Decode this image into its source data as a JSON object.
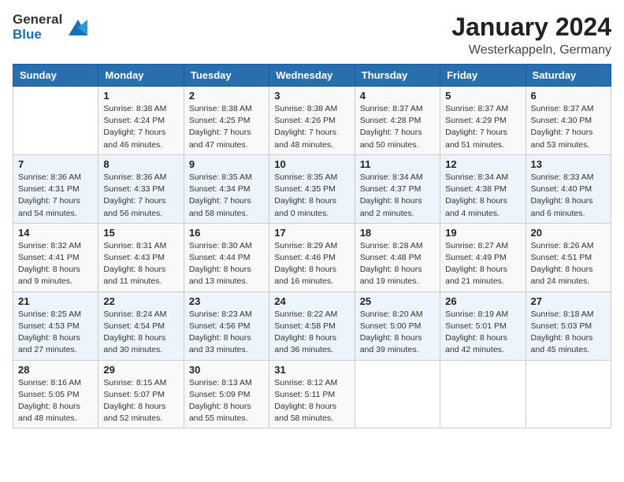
{
  "logo": {
    "general": "General",
    "blue": "Blue"
  },
  "title": "January 2024",
  "location": "Westerkappeln, Germany",
  "days_header": [
    "Sunday",
    "Monday",
    "Tuesday",
    "Wednesday",
    "Thursday",
    "Friday",
    "Saturday"
  ],
  "weeks": [
    [
      {
        "day": "",
        "sunrise": "",
        "sunset": "",
        "daylight": ""
      },
      {
        "day": "1",
        "sunrise": "Sunrise: 8:38 AM",
        "sunset": "Sunset: 4:24 PM",
        "daylight": "Daylight: 7 hours and 46 minutes."
      },
      {
        "day": "2",
        "sunrise": "Sunrise: 8:38 AM",
        "sunset": "Sunset: 4:25 PM",
        "daylight": "Daylight: 7 hours and 47 minutes."
      },
      {
        "day": "3",
        "sunrise": "Sunrise: 8:38 AM",
        "sunset": "Sunset: 4:26 PM",
        "daylight": "Daylight: 7 hours and 48 minutes."
      },
      {
        "day": "4",
        "sunrise": "Sunrise: 8:37 AM",
        "sunset": "Sunset: 4:28 PM",
        "daylight": "Daylight: 7 hours and 50 minutes."
      },
      {
        "day": "5",
        "sunrise": "Sunrise: 8:37 AM",
        "sunset": "Sunset: 4:29 PM",
        "daylight": "Daylight: 7 hours and 51 minutes."
      },
      {
        "day": "6",
        "sunrise": "Sunrise: 8:37 AM",
        "sunset": "Sunset: 4:30 PM",
        "daylight": "Daylight: 7 hours and 53 minutes."
      }
    ],
    [
      {
        "day": "7",
        "sunrise": "Sunrise: 8:36 AM",
        "sunset": "Sunset: 4:31 PM",
        "daylight": "Daylight: 7 hours and 54 minutes."
      },
      {
        "day": "8",
        "sunrise": "Sunrise: 8:36 AM",
        "sunset": "Sunset: 4:33 PM",
        "daylight": "Daylight: 7 hours and 56 minutes."
      },
      {
        "day": "9",
        "sunrise": "Sunrise: 8:35 AM",
        "sunset": "Sunset: 4:34 PM",
        "daylight": "Daylight: 7 hours and 58 minutes."
      },
      {
        "day": "10",
        "sunrise": "Sunrise: 8:35 AM",
        "sunset": "Sunset: 4:35 PM",
        "daylight": "Daylight: 8 hours and 0 minutes."
      },
      {
        "day": "11",
        "sunrise": "Sunrise: 8:34 AM",
        "sunset": "Sunset: 4:37 PM",
        "daylight": "Daylight: 8 hours and 2 minutes."
      },
      {
        "day": "12",
        "sunrise": "Sunrise: 8:34 AM",
        "sunset": "Sunset: 4:38 PM",
        "daylight": "Daylight: 8 hours and 4 minutes."
      },
      {
        "day": "13",
        "sunrise": "Sunrise: 8:33 AM",
        "sunset": "Sunset: 4:40 PM",
        "daylight": "Daylight: 8 hours and 6 minutes."
      }
    ],
    [
      {
        "day": "14",
        "sunrise": "Sunrise: 8:32 AM",
        "sunset": "Sunset: 4:41 PM",
        "daylight": "Daylight: 8 hours and 9 minutes."
      },
      {
        "day": "15",
        "sunrise": "Sunrise: 8:31 AM",
        "sunset": "Sunset: 4:43 PM",
        "daylight": "Daylight: 8 hours and 11 minutes."
      },
      {
        "day": "16",
        "sunrise": "Sunrise: 8:30 AM",
        "sunset": "Sunset: 4:44 PM",
        "daylight": "Daylight: 8 hours and 13 minutes."
      },
      {
        "day": "17",
        "sunrise": "Sunrise: 8:29 AM",
        "sunset": "Sunset: 4:46 PM",
        "daylight": "Daylight: 8 hours and 16 minutes."
      },
      {
        "day": "18",
        "sunrise": "Sunrise: 8:28 AM",
        "sunset": "Sunset: 4:48 PM",
        "daylight": "Daylight: 8 hours and 19 minutes."
      },
      {
        "day": "19",
        "sunrise": "Sunrise: 8:27 AM",
        "sunset": "Sunset: 4:49 PM",
        "daylight": "Daylight: 8 hours and 21 minutes."
      },
      {
        "day": "20",
        "sunrise": "Sunrise: 8:26 AM",
        "sunset": "Sunset: 4:51 PM",
        "daylight": "Daylight: 8 hours and 24 minutes."
      }
    ],
    [
      {
        "day": "21",
        "sunrise": "Sunrise: 8:25 AM",
        "sunset": "Sunset: 4:53 PM",
        "daylight": "Daylight: 8 hours and 27 minutes."
      },
      {
        "day": "22",
        "sunrise": "Sunrise: 8:24 AM",
        "sunset": "Sunset: 4:54 PM",
        "daylight": "Daylight: 8 hours and 30 minutes."
      },
      {
        "day": "23",
        "sunrise": "Sunrise: 8:23 AM",
        "sunset": "Sunset: 4:56 PM",
        "daylight": "Daylight: 8 hours and 33 minutes."
      },
      {
        "day": "24",
        "sunrise": "Sunrise: 8:22 AM",
        "sunset": "Sunset: 4:58 PM",
        "daylight": "Daylight: 8 hours and 36 minutes."
      },
      {
        "day": "25",
        "sunrise": "Sunrise: 8:20 AM",
        "sunset": "Sunset: 5:00 PM",
        "daylight": "Daylight: 8 hours and 39 minutes."
      },
      {
        "day": "26",
        "sunrise": "Sunrise: 8:19 AM",
        "sunset": "Sunset: 5:01 PM",
        "daylight": "Daylight: 8 hours and 42 minutes."
      },
      {
        "day": "27",
        "sunrise": "Sunrise: 8:18 AM",
        "sunset": "Sunset: 5:03 PM",
        "daylight": "Daylight: 8 hours and 45 minutes."
      }
    ],
    [
      {
        "day": "28",
        "sunrise": "Sunrise: 8:16 AM",
        "sunset": "Sunset: 5:05 PM",
        "daylight": "Daylight: 8 hours and 48 minutes."
      },
      {
        "day": "29",
        "sunrise": "Sunrise: 8:15 AM",
        "sunset": "Sunset: 5:07 PM",
        "daylight": "Daylight: 8 hours and 52 minutes."
      },
      {
        "day": "30",
        "sunrise": "Sunrise: 8:13 AM",
        "sunset": "Sunset: 5:09 PM",
        "daylight": "Daylight: 8 hours and 55 minutes."
      },
      {
        "day": "31",
        "sunrise": "Sunrise: 8:12 AM",
        "sunset": "Sunset: 5:11 PM",
        "daylight": "Daylight: 8 hours and 58 minutes."
      },
      {
        "day": "",
        "sunrise": "",
        "sunset": "",
        "daylight": ""
      },
      {
        "day": "",
        "sunrise": "",
        "sunset": "",
        "daylight": ""
      },
      {
        "day": "",
        "sunrise": "",
        "sunset": "",
        "daylight": ""
      }
    ]
  ]
}
